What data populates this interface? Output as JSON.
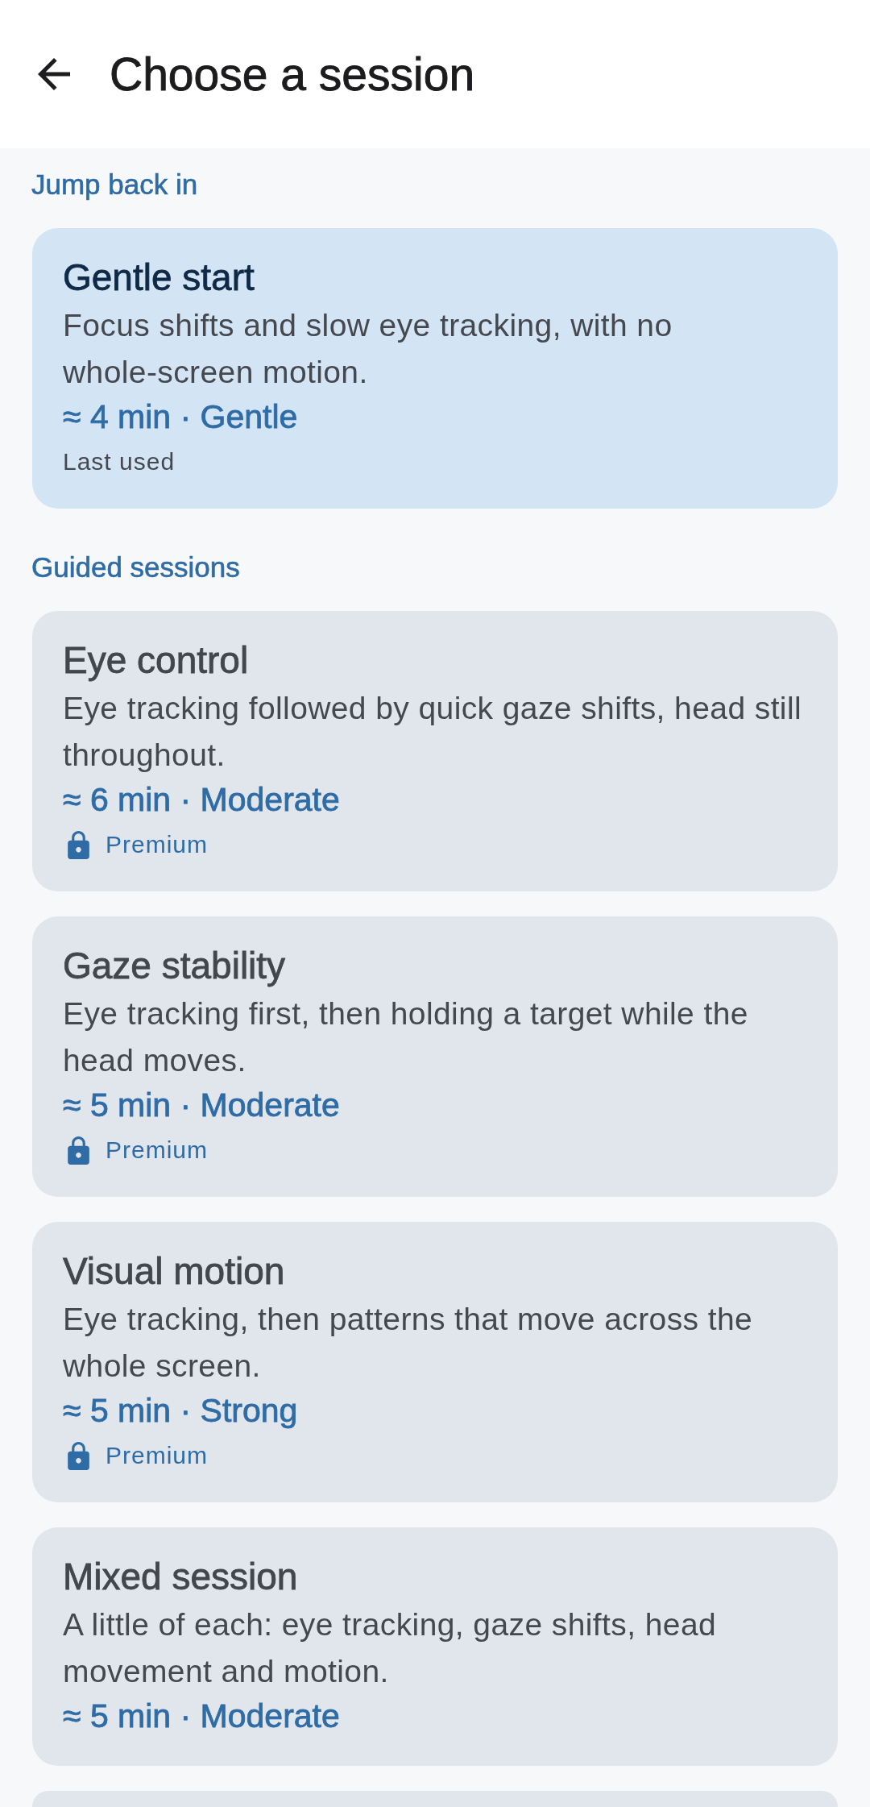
{
  "app_bar": {
    "title": "Choose a session"
  },
  "sections": [
    {
      "kind": "recent",
      "label": "Jump back in",
      "items": [
        {
          "title": "Gentle start",
          "description": "Focus shifts and slow eye tracking, with no whole-screen motion.",
          "meta": "≈ 4 min · Gentle",
          "note": "Last used"
        }
      ]
    },
    {
      "kind": "guided",
      "label": "Guided sessions",
      "items": [
        {
          "title": "Eye control",
          "description": "Eye tracking followed by quick gaze shifts, head still throughout.",
          "meta": "≈ 6 min · Moderate",
          "locked": true,
          "badge": "Premium"
        },
        {
          "title": "Gaze stability",
          "description": "Eye tracking first, then holding a target while the head moves.",
          "meta": "≈ 5 min · Moderate",
          "locked": true,
          "badge": "Premium"
        },
        {
          "title": "Visual motion",
          "description": "Eye tracking, then patterns that move across the whole screen.",
          "meta": "≈ 5 min · Strong",
          "locked": true,
          "badge": "Premium"
        },
        {
          "title": "Mixed session",
          "description": "A little of each: eye tracking, gaze shifts, head movement and motion.",
          "meta": "≈ 5 min · Moderate",
          "locked": false
        }
      ],
      "more_below": true
    }
  ]
}
